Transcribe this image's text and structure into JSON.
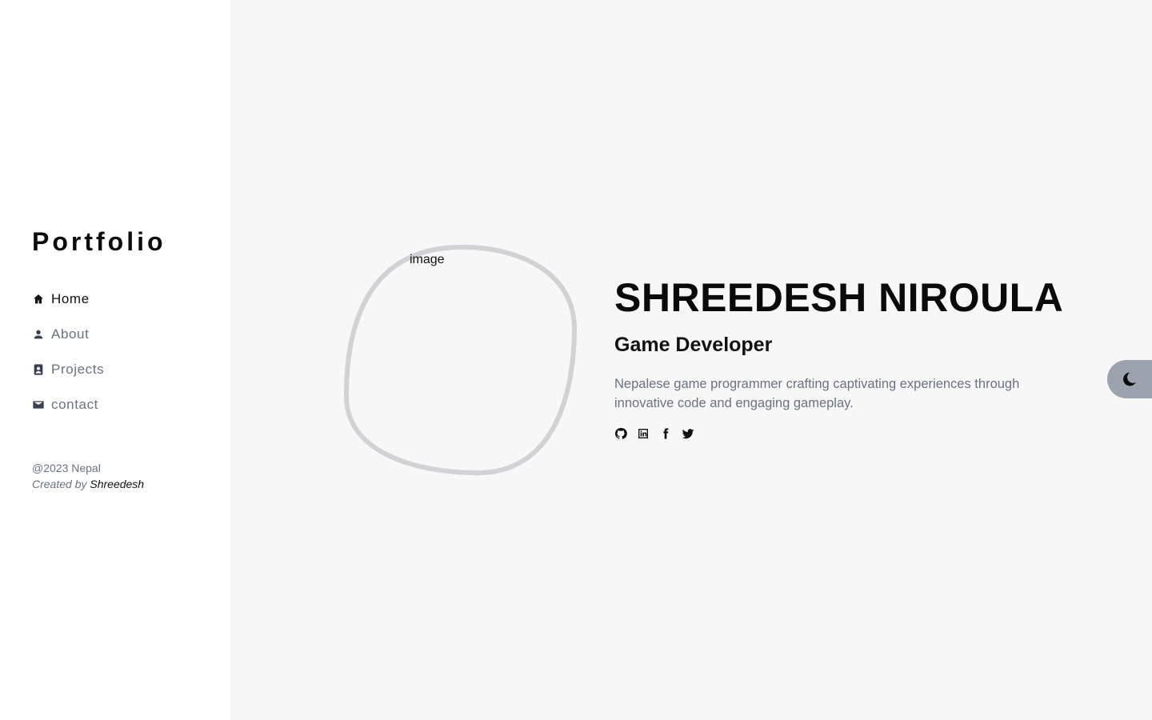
{
  "sidebar": {
    "brand": "Portfolio",
    "items": [
      {
        "label": "Home",
        "icon": "home-icon",
        "active": true
      },
      {
        "label": "About",
        "icon": "user-icon",
        "active": false
      },
      {
        "label": "Projects",
        "icon": "contact-book-icon",
        "active": false
      },
      {
        "label": "contact",
        "icon": "mail-icon",
        "active": false
      }
    ],
    "footer": {
      "copyright": "@2023 Nepal",
      "credit_prefix": "Created by ",
      "credit_name": "Shreedesh"
    }
  },
  "hero": {
    "image_alt": "image",
    "name": "SHREEDESH NIROULA",
    "role": "Game Developer",
    "description": "Nepalese game programmer crafting captivating experiences through innovative code and engaging gameplay.",
    "socials": [
      "github-icon",
      "linkedin-icon",
      "facebook-icon",
      "twitter-icon"
    ]
  },
  "theme_toggle": {
    "icon": "moon-icon"
  },
  "colors": {
    "sidebar_bg": "#ffffff",
    "main_bg": "#f7f7f7",
    "muted_text": "#6b7280",
    "blob_border": "#d1d1d6",
    "toggle_bg": "#9ca3af"
  }
}
